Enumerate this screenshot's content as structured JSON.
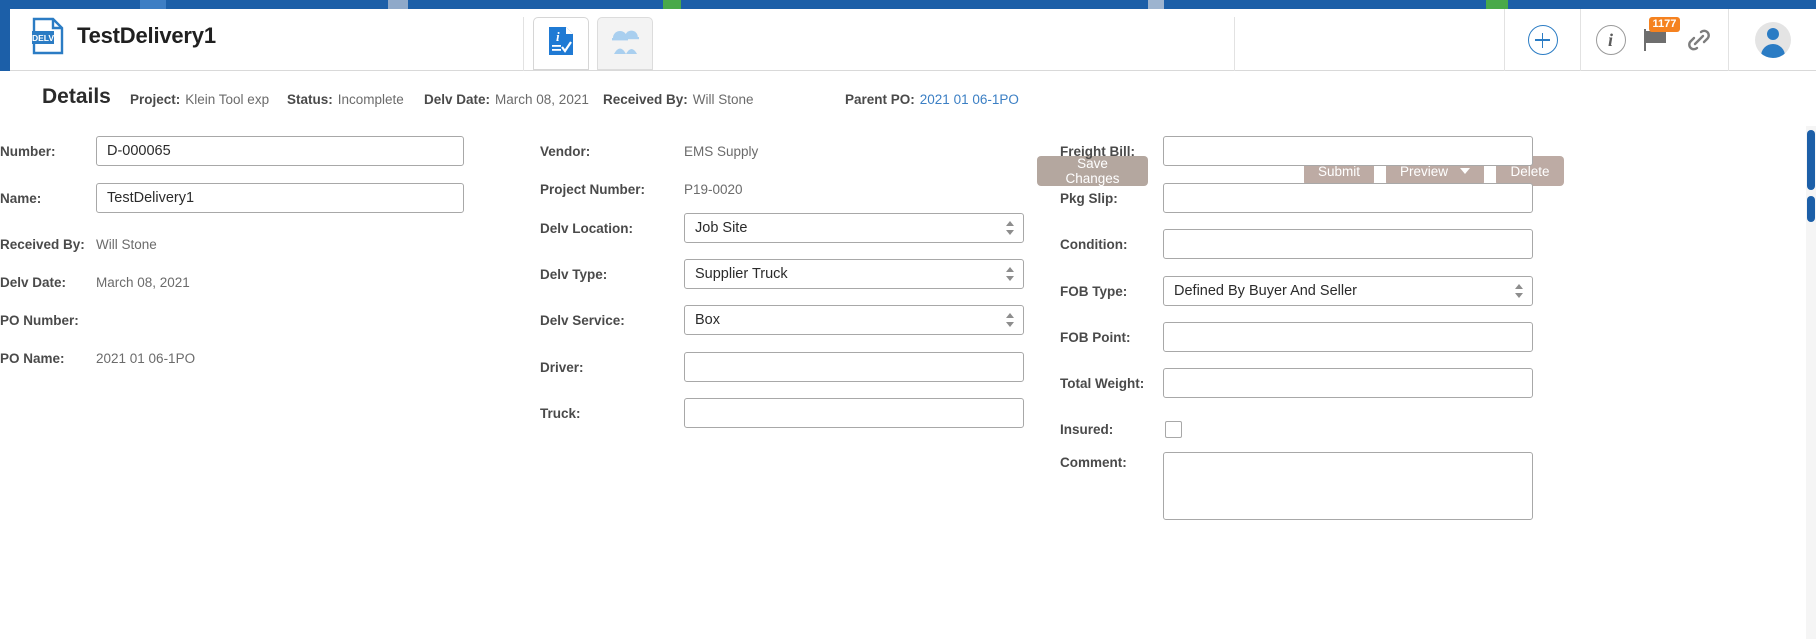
{
  "header": {
    "brand_title": "TestDelivery1",
    "brand_icon_label": "DELV",
    "tabs": [
      {
        "name": "details-tab",
        "icon": "document-info-icon",
        "active": true
      },
      {
        "name": "workers-tab",
        "icon": "workers-icon",
        "active": false
      }
    ],
    "actions": {
      "add_icon": "plus-circle-icon",
      "info_icon": "info-circle-icon",
      "flag_icon": "flag-icon",
      "flag_badge_count": "1177",
      "link_icon": "link-chain-icon",
      "avatar_icon": "user-avatar-icon"
    }
  },
  "details_bar": {
    "title": "Details",
    "meta": [
      {
        "key": "Project:",
        "value": "Klein Tool exp"
      },
      {
        "key": "Status:",
        "value": "Incomplete"
      },
      {
        "key": "Delv Date:",
        "value": "March 08, 2021"
      },
      {
        "key": "Received By:",
        "value": "Will Stone"
      },
      {
        "key": "Parent PO:",
        "value": "2021 01 06-1PO",
        "is_link": true
      }
    ],
    "buttons": {
      "save": "Save Changes",
      "submit": "Submit",
      "preview": "Preview",
      "delete": "Delete"
    }
  },
  "form": {
    "left": {
      "number_label": "Number:",
      "number_value": "D-000065",
      "name_label": "Name:",
      "name_value": "TestDelivery1",
      "received_by_label": "Received By:",
      "received_by_value": "Will Stone",
      "delv_date_label": "Delv Date:",
      "delv_date_value": "March 08, 2021",
      "po_number_label": "PO Number:",
      "po_number_value": "",
      "po_name_label": "PO Name:",
      "po_name_value": "2021 01 06-1PO"
    },
    "middle": {
      "vendor_label": "Vendor:",
      "vendor_value": "EMS Supply",
      "project_number_label": "Project Number:",
      "project_number_value": "P19-0020",
      "delv_location_label": "Delv Location:",
      "delv_location_value": "Job Site",
      "delv_type_label": "Delv Type:",
      "delv_type_value": "Supplier Truck",
      "delv_service_label": "Delv Service:",
      "delv_service_value": "Box",
      "driver_label": "Driver:",
      "driver_value": "",
      "truck_label": "Truck:",
      "truck_value": ""
    },
    "right": {
      "freight_bill_label": "Freight Bill:",
      "freight_bill_value": "",
      "pkg_slip_label": "Pkg Slip:",
      "pkg_slip_value": "",
      "condition_label": "Condition:",
      "condition_value": "",
      "fob_type_label": "FOB Type:",
      "fob_type_value": "Defined By Buyer And Seller",
      "fob_point_label": "FOB Point:",
      "fob_point_value": "",
      "total_weight_label": "Total Weight:",
      "total_weight_value": "",
      "insured_label": "Insured:",
      "insured_checked": false,
      "comment_label": "Comment:",
      "comment_value": ""
    }
  },
  "colors": {
    "brand_blue": "#1c5fa8",
    "accent_blue": "#2b7cc4",
    "link_blue": "#3b7fc4",
    "button_taupe": "#bdaba4",
    "badge_orange": "#f58220"
  }
}
